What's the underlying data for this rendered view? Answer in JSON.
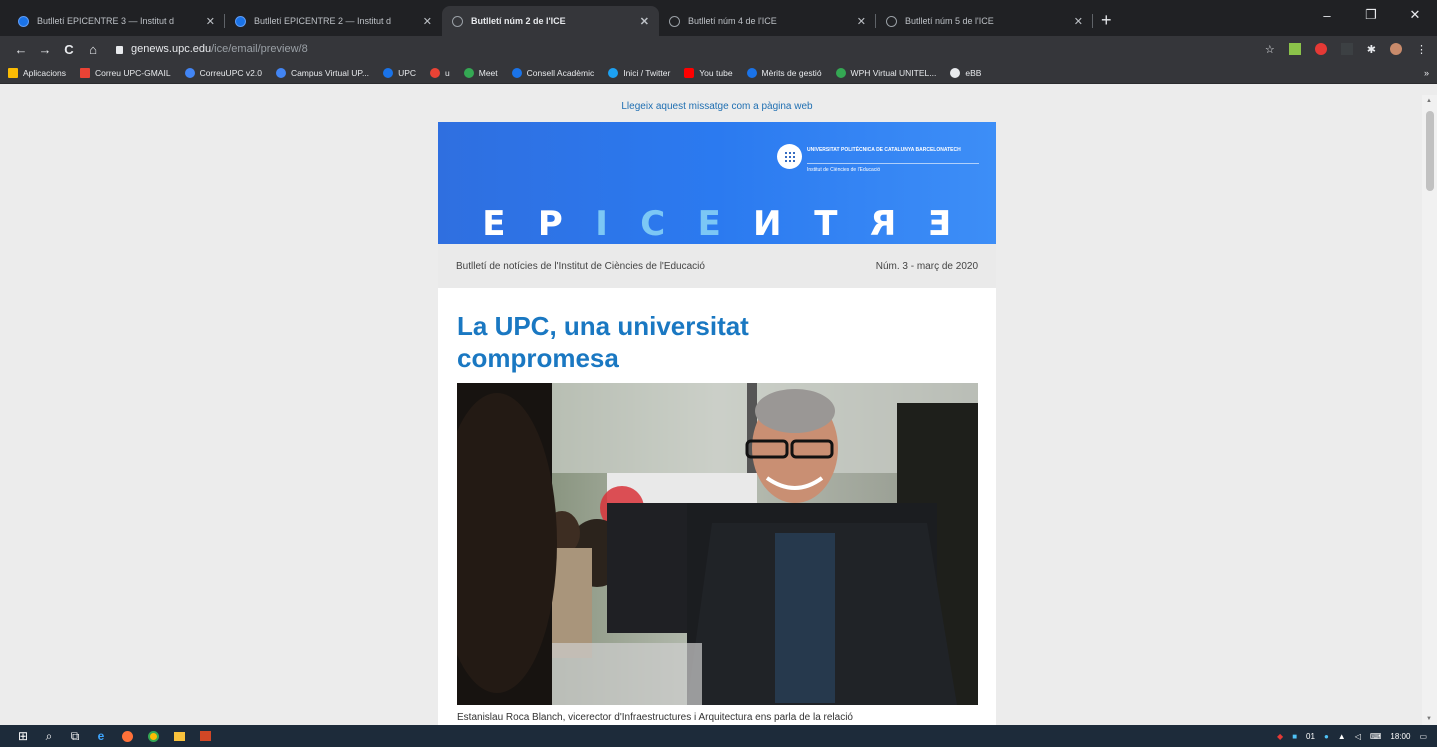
{
  "browser": {
    "tabs": [
      {
        "title": "Butlletí EPICENTRE 3 — Institut d",
        "active": false,
        "icon": "upc-favicon"
      },
      {
        "title": "Butlletí EPICENTRE 2 — Institut d",
        "active": false,
        "icon": "upc-favicon"
      },
      {
        "title": "Butlletí núm 2 de l'ICE",
        "active": true,
        "icon": "globe-favicon"
      },
      {
        "title": "Butlletí núm 4 de l'ICE",
        "active": false,
        "icon": "globe-favicon"
      },
      {
        "title": "Butlletí núm 5 de l'ICE",
        "active": false,
        "icon": "globe-favicon"
      }
    ],
    "new_tab": "+",
    "window_controls": {
      "minimize": "–",
      "maximize": "❐",
      "close": "✕"
    },
    "nav": {
      "back": "←",
      "forward": "→",
      "reload": "C",
      "home": "⌂"
    },
    "url_host": "genews.upc.edu",
    "url_path": "/ice/email/preview/8",
    "bookmarks": [
      {
        "label": "Aplicacions",
        "color": "#fbbc04"
      },
      {
        "label": "Correu UPC-GMAIL",
        "color": "#ea4335"
      },
      {
        "label": "CorreuUPC v2.0",
        "color": "#4285f4"
      },
      {
        "label": "Campus Virtual UP...",
        "color": "#4285f4"
      },
      {
        "label": "UPC",
        "color": "#1a73e8"
      },
      {
        "label": "u",
        "color": "#ea4335"
      },
      {
        "label": "Meet",
        "color": "#34a853"
      },
      {
        "label": "Consell Acadèmic",
        "color": "#1a73e8"
      },
      {
        "label": "Inici / Twitter",
        "color": "#1da1f2"
      },
      {
        "label": "You tube",
        "color": "#ff0000"
      },
      {
        "label": "Mèrits de gestió",
        "color": "#1a73e8"
      },
      {
        "label": "WPH Virtual UNITEL...",
        "color": "#34a853"
      },
      {
        "label": "eBB",
        "color": "#e8eaed"
      }
    ],
    "bookmarks_more": "»"
  },
  "email": {
    "web_link": "Llegeix aquest missatge com a pàgina web",
    "banner": {
      "university_name": "UNIVERSITAT POLITÈCNICA DE CATALUNYA BARCELONATECH",
      "institute": "Institut de Ciències de l'Educació",
      "logo_text": "UPC",
      "letters": [
        "E",
        "P",
        "I",
        "C",
        "E",
        "N",
        "T",
        "R",
        "E"
      ]
    },
    "subtitle": "Butlletí de notícies de l'Institut de Ciències de l'Educació",
    "issue": "Núm. 3 - març de 2020",
    "headline": "La UPC, una universitat compromesa",
    "caption": "Estanislau Roca Blanch, vicerector d'Infraestructures i Arquitectura ens parla de la relació"
  },
  "taskbar": {
    "start": "⊞",
    "search": "⌕",
    "task_view": "⧉",
    "time": "18:00",
    "tray_label": "01"
  }
}
